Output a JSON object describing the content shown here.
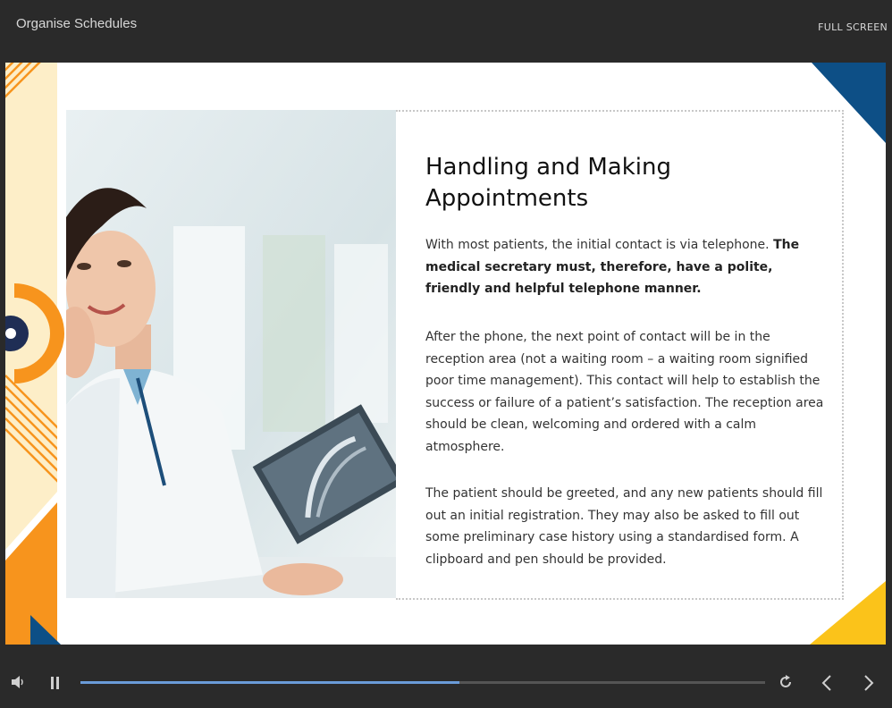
{
  "header": {
    "title": "Organise Schedules",
    "fullscreen_label": "FULL SCREEN"
  },
  "slide": {
    "heading": "Handling and Making Appointments",
    "paragraph1_plain": "With most patients, the initial contact is via telephone.",
    "paragraph1_bold": "The medical secretary must, therefore, have a polite, friendly and helpful telephone manner.",
    "paragraph2": "After the phone, the next point of contact will be in the reception area (not a waiting room – a waiting room signified poor time management). This contact will help to establish the success or failure of a patient’s satisfaction. The reception area should be clean, welcoming and ordered with a calm atmosphere.",
    "paragraph3": "The patient should be greeted, and any new patients should fill out an initial registration. They may also be asked to fill out some preliminary case history using a standardised form. A clipboard and pen should be provided.",
    "image_alt": "Smiling doctor on the phone holding an x-ray",
    "colors": {
      "orange": "#f7941d",
      "pale_yellow": "#fdeec8",
      "navy": "#1f2e55",
      "blue": "#0d4f86",
      "yellow": "#fbc31a"
    }
  },
  "player": {
    "progress": 0.553,
    "icons": [
      "volume-icon",
      "pause-icon",
      "replay-icon",
      "chevron-left-icon",
      "chevron-right-icon"
    ]
  }
}
